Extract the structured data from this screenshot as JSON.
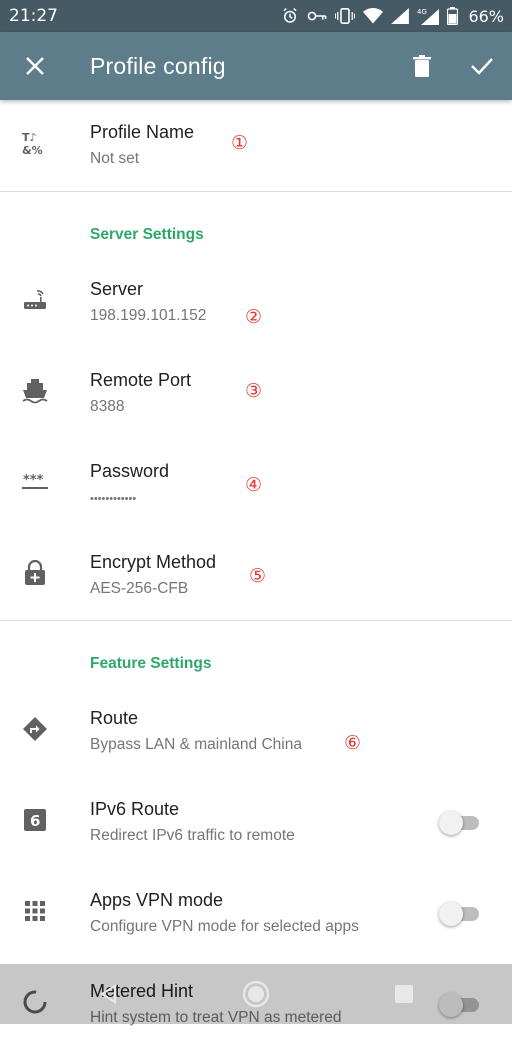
{
  "status_bar": {
    "time": "21:27",
    "battery": "66%",
    "network_label": "4G"
  },
  "toolbar": {
    "title": "Profile config",
    "close_icon": "close-icon",
    "delete_icon": "trash-icon",
    "save_icon": "check-icon"
  },
  "profile": {
    "title": "Profile Name",
    "value": "Not set",
    "marker": "①"
  },
  "server_settings": {
    "heading": "Server Settings",
    "items": [
      {
        "title": "Server",
        "value": "198.199.101.152",
        "marker": "②",
        "icon": "router-icon"
      },
      {
        "title": "Remote Port",
        "value": "8388",
        "marker": "③",
        "icon": "ship-icon"
      },
      {
        "title": "Password",
        "value": "••••••••••••",
        "marker": "④",
        "icon": "password-icon"
      },
      {
        "title": "Encrypt Method",
        "value": "AES-256-CFB",
        "marker": "⑤",
        "icon": "lock-icon"
      }
    ]
  },
  "feature_settings": {
    "heading": "Feature Settings",
    "route": {
      "title": "Route",
      "value": "Bypass LAN & mainland China",
      "marker": "⑥",
      "icon": "directions-icon"
    },
    "ipv6": {
      "title": "IPv6 Route",
      "value": "Redirect IPv6 traffic to remote",
      "icon": "ipv6-icon",
      "enabled": false
    },
    "apps_vpn": {
      "title": "Apps VPN mode",
      "value": "Configure VPN mode for selected apps",
      "icon": "apps-grid-icon",
      "enabled": false
    },
    "metered": {
      "title": "Metered Hint",
      "value": "Hint system to treat VPN as metered",
      "icon": "data-usage-icon",
      "enabled": false
    }
  },
  "colors": {
    "toolbar": "#5e7d8b",
    "status_bar": "#455a64",
    "section_heading": "#2ea86a",
    "marker": "#e53935"
  }
}
